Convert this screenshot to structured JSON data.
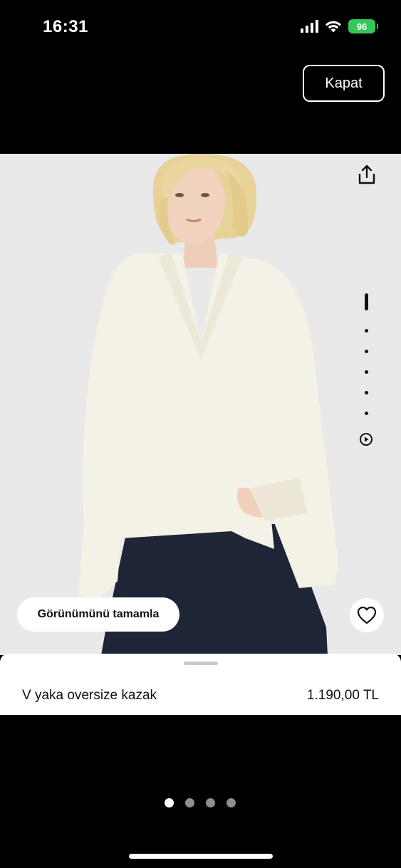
{
  "status_bar": {
    "time": "16:31",
    "battery": "96",
    "icons": [
      "signal-icon",
      "wifi-icon",
      "battery-icon"
    ]
  },
  "header": {
    "close_label": "Kapat"
  },
  "product": {
    "name": "V yaka oversize kazak",
    "price": "1.190,00 TL",
    "complete_look_label": "Görünümünü tamamla",
    "image_count": 6,
    "current_image": 1,
    "has_video": true
  },
  "carousel": {
    "page_count": 4,
    "current_page": 1
  },
  "colors": {
    "background": "#000000",
    "image_bg": "#e9e9ea",
    "battery": "#34c759",
    "sweater": "#f4f1e6",
    "skirt": "#1d2536"
  }
}
